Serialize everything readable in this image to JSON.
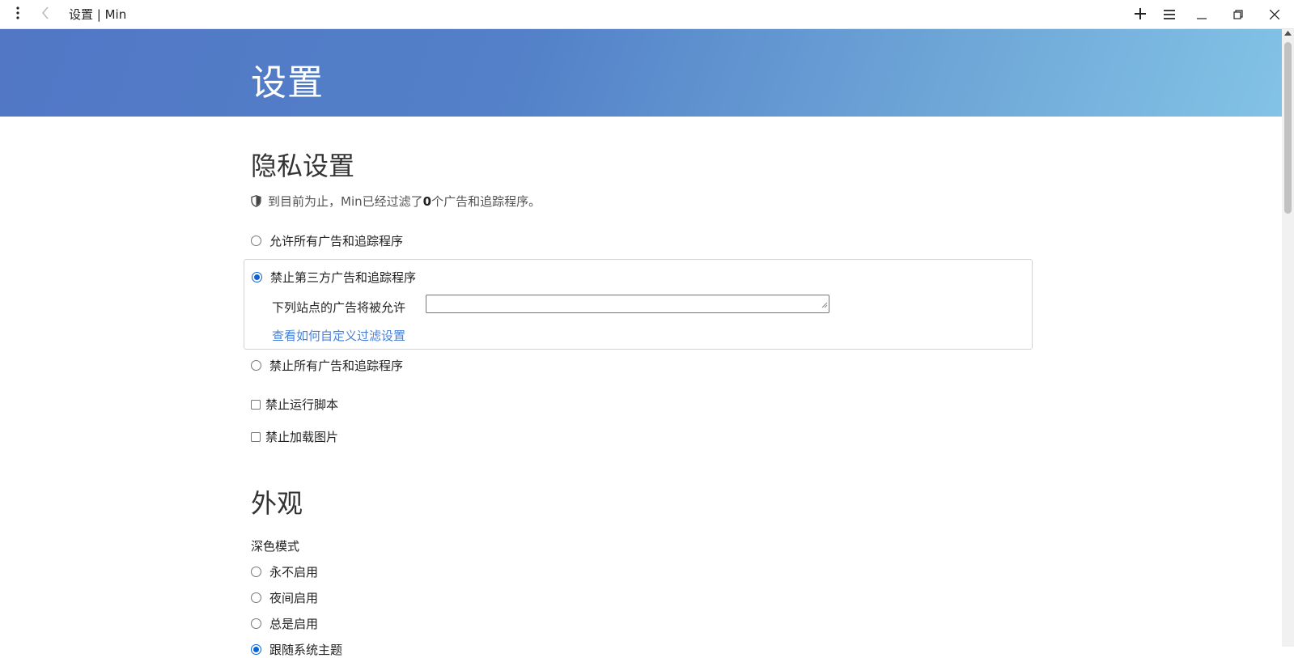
{
  "window": {
    "title": "设置 | Min"
  },
  "icons": {
    "menu": "vertical-dots-icon",
    "back": "chevron-left-icon",
    "new_tab": "plus-icon",
    "tasks": "hamburger-icon",
    "minimize": "minimize-icon",
    "restore": "restore-icon",
    "close": "close-icon",
    "shield": "shield-icon"
  },
  "header": {
    "title": "设置"
  },
  "privacy": {
    "title": "隐私设置",
    "blocked_prefix": "到目前为止，Min已经过滤了",
    "blocked_count": "0",
    "blocked_suffix": "个广告和追踪程序。",
    "options": [
      {
        "label": "允许所有广告和追踪程序",
        "checked": false
      },
      {
        "label": "禁止第三方广告和追踪程序",
        "checked": true
      },
      {
        "label": "禁止所有广告和追踪程序",
        "checked": false
      }
    ],
    "whitelist_label": "下列站点的广告将被允许",
    "whitelist_value": "",
    "custom_filter_link": "查看如何自定义过滤设置",
    "block_scripts": "禁止运行脚本",
    "block_images": "禁止加载图片"
  },
  "appearance": {
    "title": "外观",
    "dark_mode_label": "深色模式",
    "dark_mode_options": [
      {
        "label": "永不启用",
        "checked": false
      },
      {
        "label": "夜间启用",
        "checked": false
      },
      {
        "label": "总是启用",
        "checked": false
      },
      {
        "label": "跟随系统主题",
        "checked": true
      }
    ]
  },
  "colors": {
    "accent": "#0a64d6",
    "link": "#4a7fd8",
    "banner_start": "#5177c5",
    "banner_end": "#83c3e6"
  }
}
